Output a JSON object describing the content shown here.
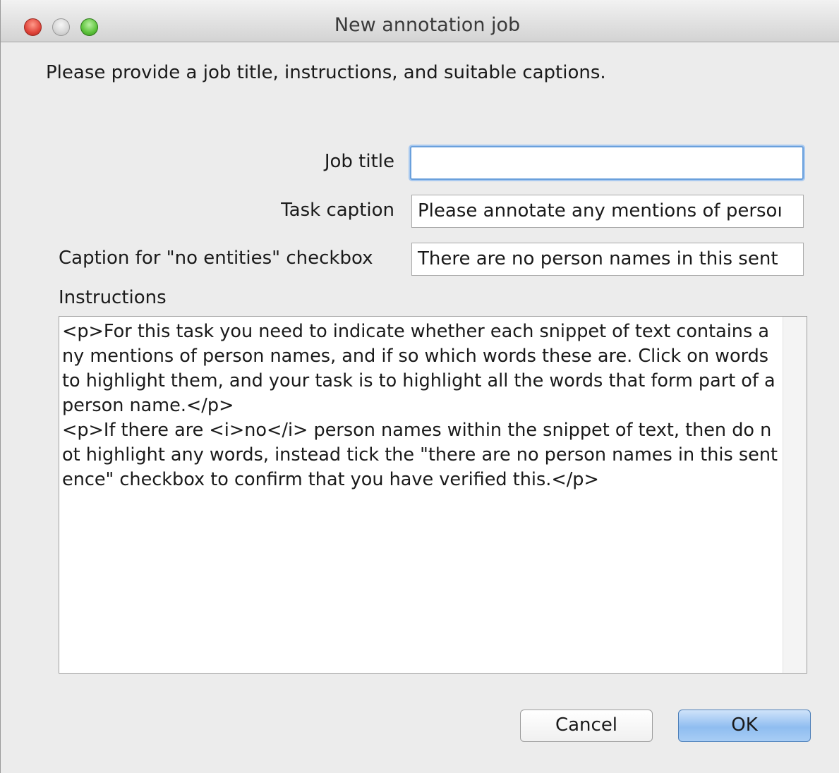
{
  "window": {
    "title": "New annotation job"
  },
  "prompt": "Please provide a job title, instructions, and suitable captions.",
  "fields": {
    "job_title_label": "Job title",
    "job_title_value": "",
    "task_caption_label": "Task caption",
    "task_caption_value": "Please annotate any mentions of persoı",
    "no_entities_label": "Caption for \"no entities\" checkbox",
    "no_entities_value": "There are no person names in this sent"
  },
  "instructions": {
    "label": "Instructions",
    "value": "<p>For this task you need to indicate whether each snippet of text contains any mentions of person names, and if so which words these are. Click on words to highlight them, and your task is to highlight all the words that form part of a person name.</p>\n<p>If there are <i>no</i> person names within the snippet of text, then do not highlight any words, instead tick the \"there are no person names in this sentence\" checkbox to confirm that you have verified this.</p>"
  },
  "buttons": {
    "cancel": "Cancel",
    "ok": "OK"
  },
  "colors": {
    "window_bg": "#ececec",
    "ok_button": "#8fbdf0",
    "focus_ring": "#6aa0dc"
  }
}
